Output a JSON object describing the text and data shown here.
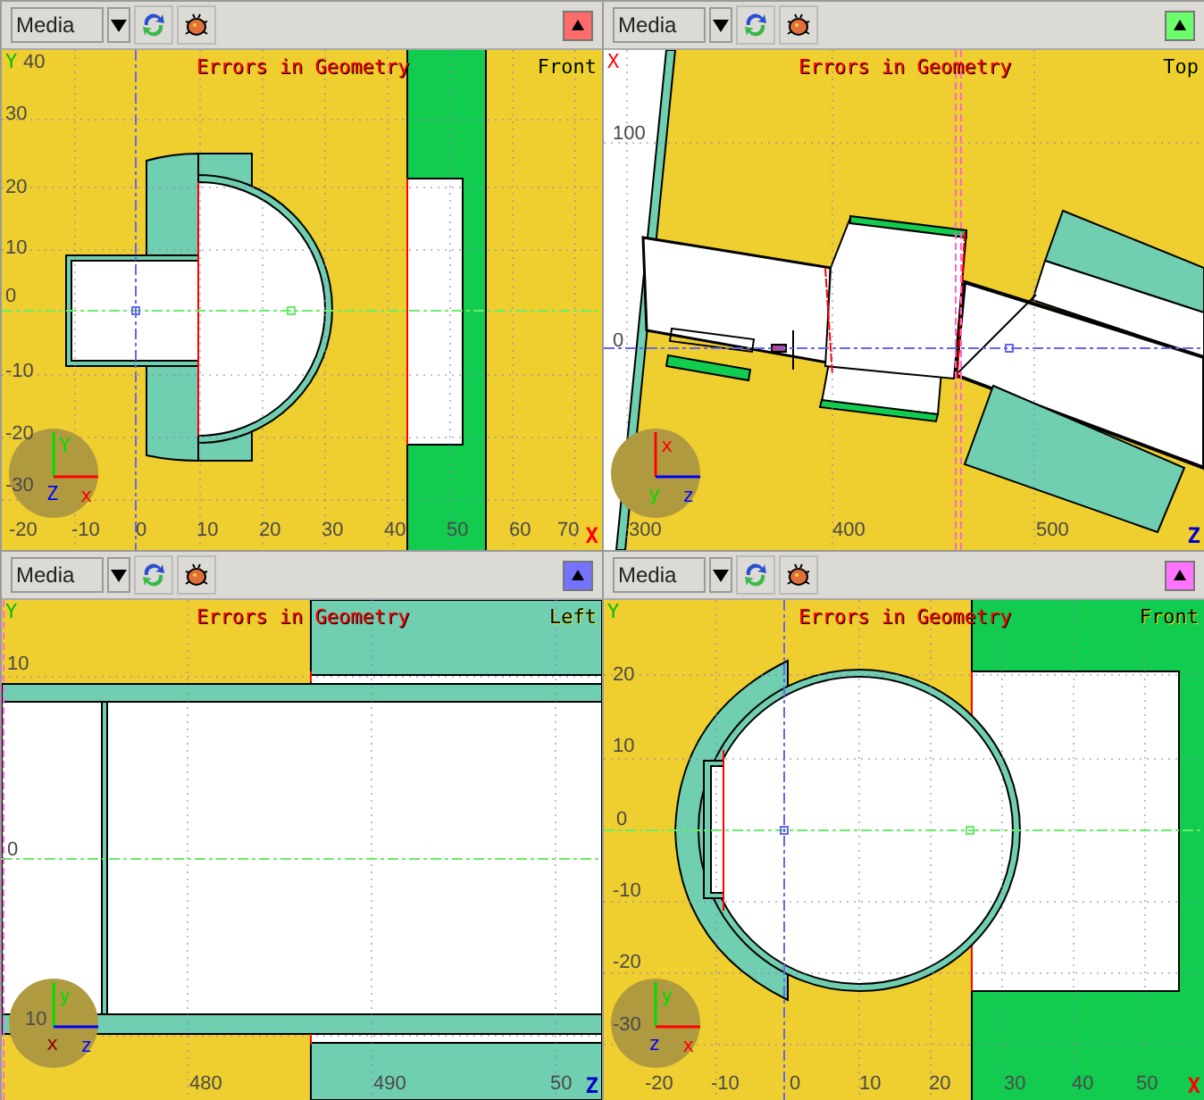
{
  "viewports": [
    {
      "media": "Media",
      "color": "#ff6b6b",
      "title": "Errors in Geometry",
      "view": "Front",
      "corner_axis": {
        "text": "Y",
        "color": "#00c000"
      },
      "end_axis": {
        "text": "X",
        "color": "#ff0000"
      },
      "y_ticks": [
        "40",
        "30",
        "20",
        "10",
        "0",
        "-10",
        "-20",
        "-30"
      ],
      "x_ticks": [
        "-20",
        "-10",
        "0",
        "10",
        "20",
        "30",
        "40",
        "50",
        "60",
        "70"
      ],
      "gizmo": {
        "up": {
          "text": "Y",
          "color": "#00dd00"
        },
        "below": {
          "text": "Z",
          "color": "#0000ff"
        },
        "right": {
          "text": "x",
          "color": "#ff0000"
        }
      }
    },
    {
      "media": "Media",
      "color": "#6bff6b",
      "title": "Errors in Geometry",
      "view": "Top",
      "corner_axis": {
        "text": "X",
        "color": "#ff0000"
      },
      "end_axis": {
        "text": "Z",
        "color": "#0000cc"
      },
      "y_ticks": [
        "100",
        "0"
      ],
      "x_ticks": [
        "300",
        "400",
        "500"
      ],
      "gizmo": {
        "up": {
          "text": "x",
          "color": "#ff0000"
        },
        "below": {
          "text": "y",
          "color": "#00dd00"
        },
        "right": {
          "text": "z",
          "color": "#0000ff"
        }
      }
    },
    {
      "media": "Media",
      "color": "#7373ff",
      "title": "Errors in Geometry",
      "view": "Left",
      "corner_axis": {
        "text": "Y",
        "color": "#00c000"
      },
      "end_axis": {
        "text": "Z",
        "color": "#0000cc"
      },
      "y_ticks": [
        "10",
        "0",
        "10"
      ],
      "x_ticks": [
        "480",
        "490",
        "50"
      ],
      "gizmo": {
        "up": {
          "text": "y",
          "color": "#00dd00"
        },
        "below": {
          "text": "x",
          "color": "#8b0000"
        },
        "right": {
          "text": "z",
          "color": "#0000ff"
        }
      }
    },
    {
      "media": "Media",
      "color": "#ff73ff",
      "title": "Errors in Geometry",
      "view": "Front",
      "corner_axis": {
        "text": "Y",
        "color": "#00c000"
      },
      "end_axis": {
        "text": "X",
        "color": "#ff0000"
      },
      "y_ticks": [
        "20",
        "10",
        "0",
        "-10",
        "-20",
        "-30"
      ],
      "x_ticks": [
        "-20",
        "-10",
        "0",
        "10",
        "20",
        "30",
        "40",
        "50"
      ],
      "gizmo": {
        "up": {
          "text": "y",
          "color": "#00dd00"
        },
        "below": {
          "text": "z",
          "color": "#0000ff"
        },
        "right": {
          "text": "x",
          "color": "#ff0000"
        }
      }
    }
  ]
}
